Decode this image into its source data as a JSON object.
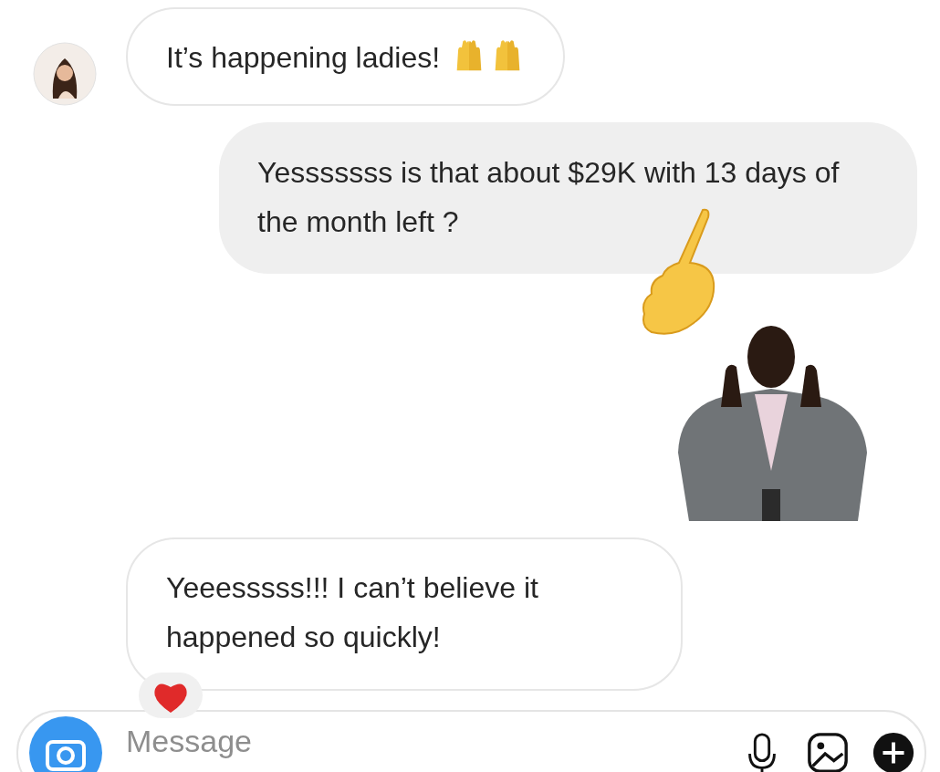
{
  "messages": [
    {
      "kind": "incoming",
      "text": "It’s happening ladies!",
      "emojis": [
        {
          "kind": "raised-hands"
        },
        {
          "kind": "raised-hands"
        }
      ],
      "reaction": false
    },
    {
      "kind": "outgoing",
      "text": "Yesssssss is that about $29K with 13 days of the month left ?",
      "emojis": [
        {
          "kind": "pointing-hand"
        }
      ],
      "reaction": false
    },
    {
      "kind": "sticker"
    },
    {
      "kind": "incoming",
      "text": "Yeeesssss!!! I can’t believe it happened so quickly!",
      "reaction": true
    }
  ],
  "composer": {
    "placeholder": "Message"
  }
}
